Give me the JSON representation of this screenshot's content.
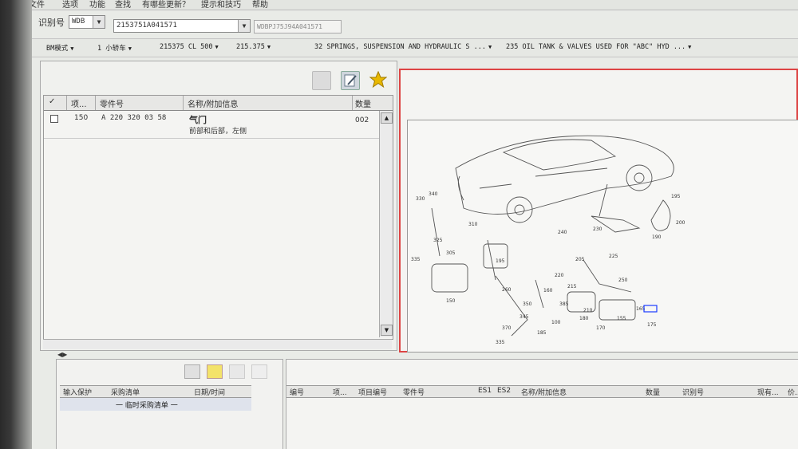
{
  "menu": {
    "items": [
      "文件",
      "选项",
      "功能",
      "查找",
      "有哪些更新？",
      "提示和技巧",
      "帮助"
    ]
  },
  "idbar": {
    "label": "识别号",
    "prefix_value": "WDB",
    "id_value": "2153751A041571",
    "vin_value": "WDBPJ75J94A041571"
  },
  "nav": {
    "items": [
      "BM模式",
      "1 小轿车",
      "215375 CL 500",
      "215.375",
      "32 SPRINGS, SUSPENSION AND HYDRAULIC S ...",
      "235 OIL TANK & VALVES USED FOR \"ABC\" HYD ..."
    ]
  },
  "parts_table": {
    "headers": [
      "✓",
      "项...",
      "零件号",
      "名称/附加信息",
      "数量"
    ],
    "rows": [
      {
        "item": "150",
        "part_no": "A 220 320 03 58",
        "name": "气门",
        "info": "前部和后部，左侧",
        "qty": "002"
      }
    ]
  },
  "diagram": {
    "callouts": [
      "330",
      "340",
      "325",
      "335",
      "310",
      "305",
      "195",
      "150",
      "350",
      "345",
      "370",
      "335",
      "240",
      "230",
      "205",
      "225",
      "220",
      "250",
      "385",
      "195",
      "190",
      "200",
      "215",
      "160",
      "180",
      "100",
      "175",
      "165",
      "155",
      "170",
      "185",
      "210",
      "260"
    ]
  },
  "bottom_left": {
    "headers": [
      "输入保护",
      "采购清单",
      "日期/时间"
    ],
    "rows": [
      {
        "name": "一 临时采购清单 一"
      }
    ]
  },
  "bottom_right": {
    "headers": [
      "编号",
      "项...",
      "项目编号",
      "零件号",
      "ES1",
      "ES2",
      "名称/附加信息",
      "数量",
      "识别号",
      "现有...",
      "价..."
    ]
  },
  "colors": {
    "accent_red": "#d44444",
    "star": "#e8b800"
  }
}
